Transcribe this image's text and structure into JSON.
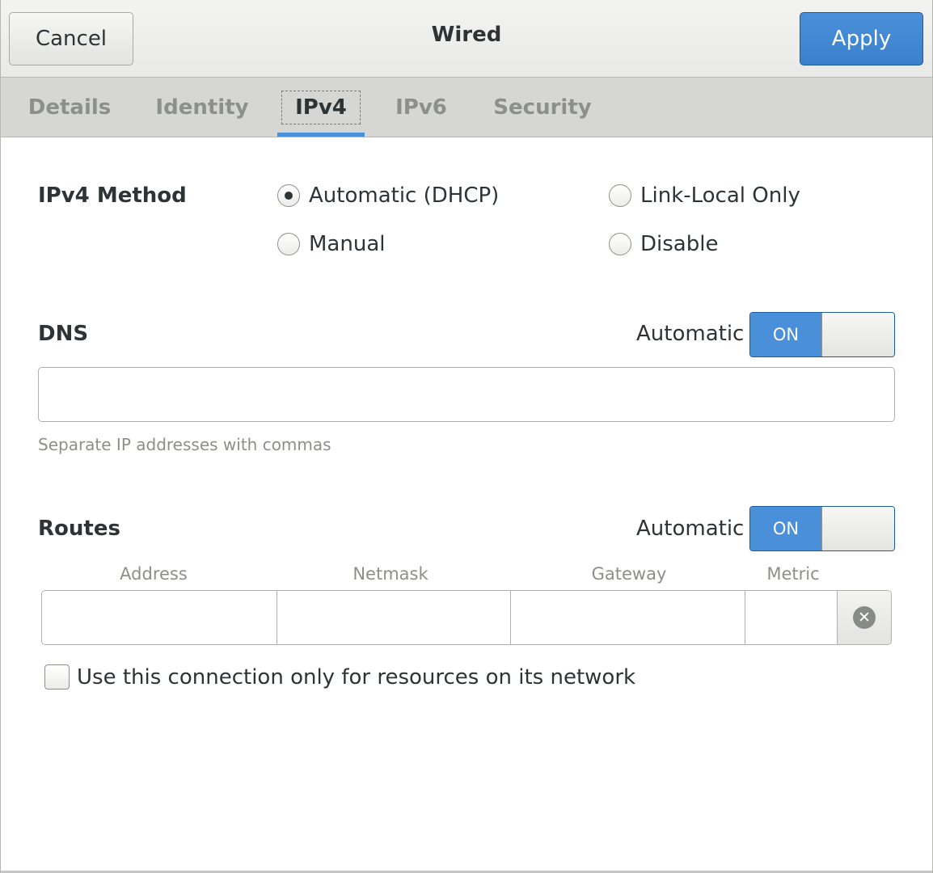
{
  "header": {
    "title": "Wired",
    "cancel_label": "Cancel",
    "apply_label": "Apply"
  },
  "tabs": [
    {
      "label": "Details"
    },
    {
      "label": "Identity"
    },
    {
      "label": "IPv4"
    },
    {
      "label": "IPv6"
    },
    {
      "label": "Security"
    }
  ],
  "active_tab": "IPv4",
  "ipv4_method": {
    "label": "IPv4 Method",
    "options": [
      {
        "label": "Automatic (DHCP)",
        "checked": true
      },
      {
        "label": "Link-Local Only",
        "checked": false
      },
      {
        "label": "Manual",
        "checked": false
      },
      {
        "label": "Disable",
        "checked": false
      }
    ]
  },
  "dns": {
    "label": "DNS",
    "automatic_label": "Automatic",
    "switch_label": "ON",
    "value": "",
    "hint": "Separate IP addresses with commas"
  },
  "routes": {
    "label": "Routes",
    "automatic_label": "Automatic",
    "switch_label": "ON",
    "columns": [
      "Address",
      "Netmask",
      "Gateway",
      "Metric"
    ],
    "only_local_label": "Use this connection only for resources on its network",
    "only_local_checked": false
  },
  "colors": {
    "accent": "#4a90d9",
    "header_bg": "#efefee",
    "tab_bar_bg": "#d6d6d4"
  },
  "icons": {
    "delete_route": "remove-circle-icon"
  }
}
